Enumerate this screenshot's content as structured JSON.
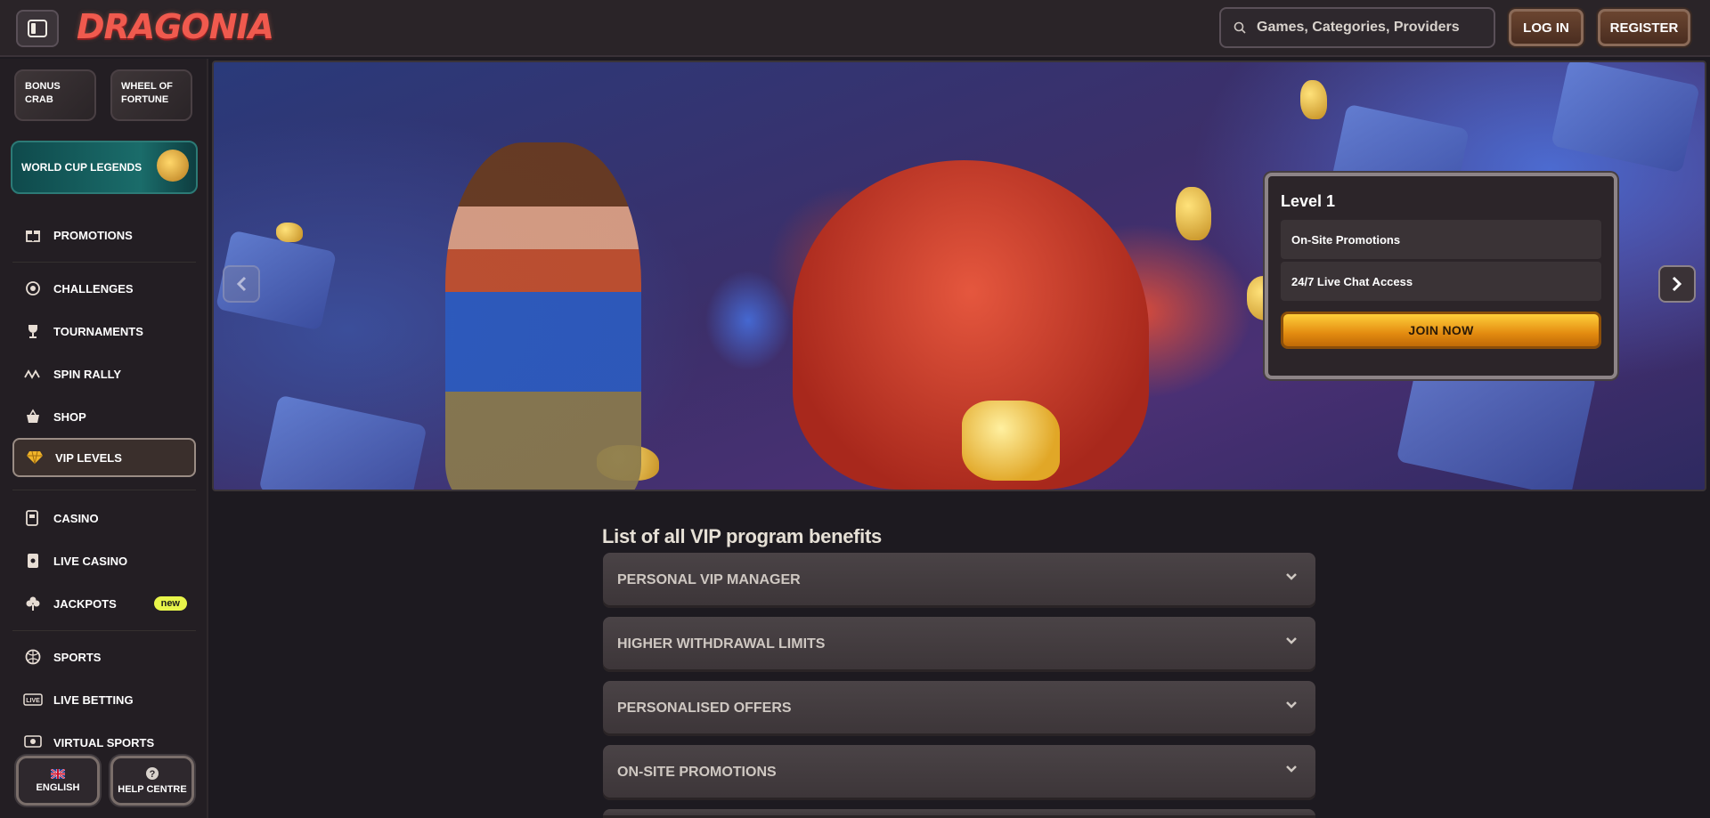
{
  "header": {
    "logo_text": "DRAGONIA",
    "search_placeholder": "Games, Categories, Providers",
    "login_label": "LOG IN",
    "register_label": "REGISTER"
  },
  "sidebar": {
    "tiles": {
      "bonus_crab": "BONUS CRAB",
      "wheel_of_fortune": "WHEEL OF FORTUNE",
      "world_cup": "WORLD CUP LEGENDS"
    },
    "items": [
      {
        "label": "PROMOTIONS",
        "icon": "gift-icon"
      },
      {
        "label": "CHALLENGES",
        "icon": "target-icon"
      },
      {
        "label": "TOURNAMENTS",
        "icon": "trophy-icon"
      },
      {
        "label": "SPIN RALLY",
        "icon": "rally-icon"
      },
      {
        "label": "SHOP",
        "icon": "basket-icon"
      },
      {
        "label": "VIP LEVELS",
        "icon": "diamond-icon",
        "active": true
      },
      {
        "label": "CASINO",
        "icon": "slot-machine-icon"
      },
      {
        "label": "LIVE CASINO",
        "icon": "card-icon"
      },
      {
        "label": "JACKPOTS",
        "icon": "clover-icon",
        "badge": "new"
      },
      {
        "label": "SPORTS",
        "icon": "ball-icon"
      },
      {
        "label": "LIVE BETTING",
        "icon": "live-icon"
      },
      {
        "label": "VIRTUAL SPORTS",
        "icon": "virtual-icon"
      }
    ],
    "footer": {
      "language": "ENGLISH",
      "help": "HELP CENTRE"
    }
  },
  "hero": {
    "card": {
      "title": "Level 1",
      "benefits": [
        "On-Site Promotions",
        "24/7 Live Chat Access"
      ],
      "cta": "JOIN NOW"
    }
  },
  "benefits": {
    "title": "List of all VIP program benefits",
    "items": [
      "PERSONAL VIP MANAGER",
      "HIGHER WITHDRAWAL LIMITS",
      "PERSONALISED OFFERS",
      "ON-SITE PROMOTIONS"
    ]
  },
  "colors": {
    "accent_gold": "#e8a317",
    "badge_new": "#e8f54a",
    "logo_red": "#f05a4e"
  }
}
